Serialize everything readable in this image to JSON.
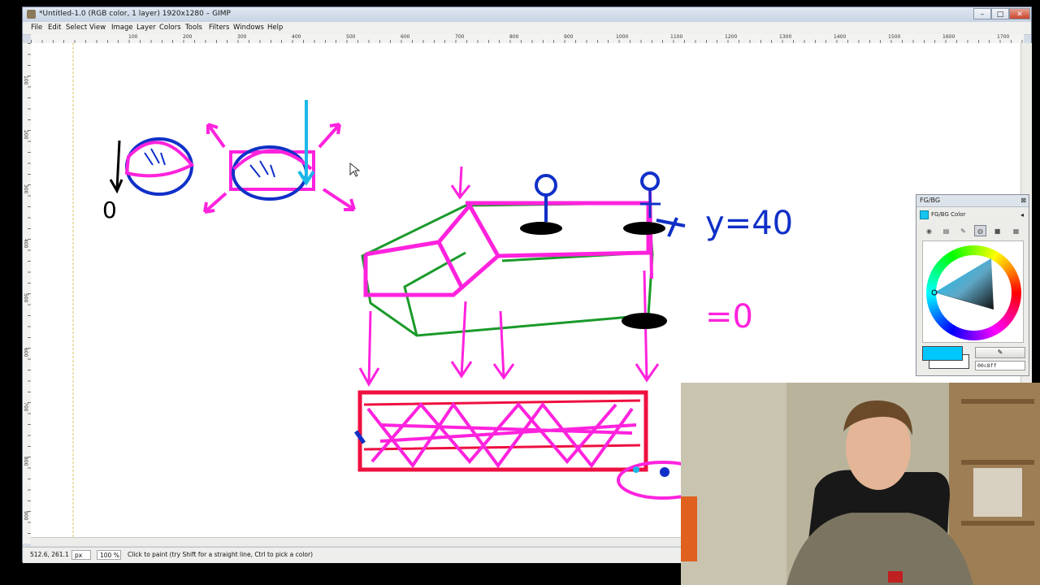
{
  "window": {
    "title": "*Untitled-1.0 (RGB color, 1 layer) 1920x1280 – GIMP",
    "controls": {
      "minimize": "–",
      "maximize": "□",
      "close": "✕"
    }
  },
  "menu": [
    {
      "label": "File"
    },
    {
      "label": "Edit"
    },
    {
      "label": "Select"
    },
    {
      "label": "View"
    },
    {
      "label": "Image"
    },
    {
      "label": "Layer"
    },
    {
      "label": "Colors"
    },
    {
      "label": "Tools"
    },
    {
      "label": "Filters"
    },
    {
      "label": "Windows"
    },
    {
      "label": "Help"
    }
  ],
  "ruler": {
    "horizontal_labels": [
      "100",
      "200",
      "300",
      "400",
      "500",
      "600",
      "700",
      "800",
      "900",
      "1000",
      "1100",
      "1200",
      "1300",
      "1400",
      "1500",
      "1600",
      "1700"
    ],
    "vertical_labels": [
      "100",
      "200",
      "300",
      "400",
      "500",
      "600",
      "700",
      "800",
      "900",
      "1000",
      "1100",
      "1200"
    ]
  },
  "statusbar": {
    "coordinates": "512.6, 261.1",
    "unit": "px",
    "zoom": "100 %",
    "message": "Click to paint (try Shift for a straight line, Ctrl to pick a color)"
  },
  "dock": {
    "title": "FG/BG",
    "tab_label": "FG/BG Color",
    "hex_value": "00c8ff",
    "fg_color": "#00c8ff",
    "bg_color": "#ffffff"
  },
  "drawing": {
    "equation_y": "y=40",
    "equation_zero": "=0",
    "left_zero": "0"
  },
  "colors": {
    "magenta": "#ff22dd",
    "green": "#1a9a2a",
    "blue": "#1030c8",
    "red": "#ee1040",
    "cyan": "#1ab8e8",
    "black": "#000000"
  }
}
